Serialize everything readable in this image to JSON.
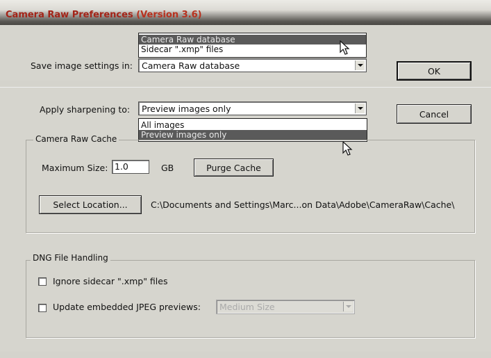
{
  "window": {
    "title": "Camera Raw Preferences",
    "version": "(Version 3.6)"
  },
  "save_settings": {
    "label": "Save image settings in:",
    "value": "Camera Raw database",
    "options": [
      "Camera Raw database",
      "Sidecar \".xmp\" files"
    ],
    "highlighted": "Camera Raw database"
  },
  "sharpening": {
    "label": "Apply sharpening to:",
    "value": "Preview images only",
    "options": [
      "All images",
      "Preview images only"
    ],
    "highlighted": "Preview images only"
  },
  "buttons": {
    "ok": "OK",
    "cancel": "Cancel"
  },
  "cache": {
    "group_title": "Camera Raw Cache",
    "max_size_label": "Maximum Size:",
    "max_size_value": "1.0",
    "unit": "GB",
    "purge_button": "Purge Cache",
    "select_location_button": "Select Location...",
    "path": "C:\\Documents and Settings\\Marc...on Data\\Adobe\\CameraRaw\\Cache\\"
  },
  "dng": {
    "group_title": "DNG File Handling",
    "ignore_sidecar_label": "Ignore sidecar \".xmp\" files",
    "ignore_sidecar_checked": false,
    "update_previews_label": "Update embedded JPEG previews:",
    "update_previews_checked": false,
    "preview_size_value": "Medium Size"
  },
  "colors": {
    "title": "#a32418",
    "dialog_bg": "#d6d5ce",
    "highlight": "#5a5a5a"
  }
}
